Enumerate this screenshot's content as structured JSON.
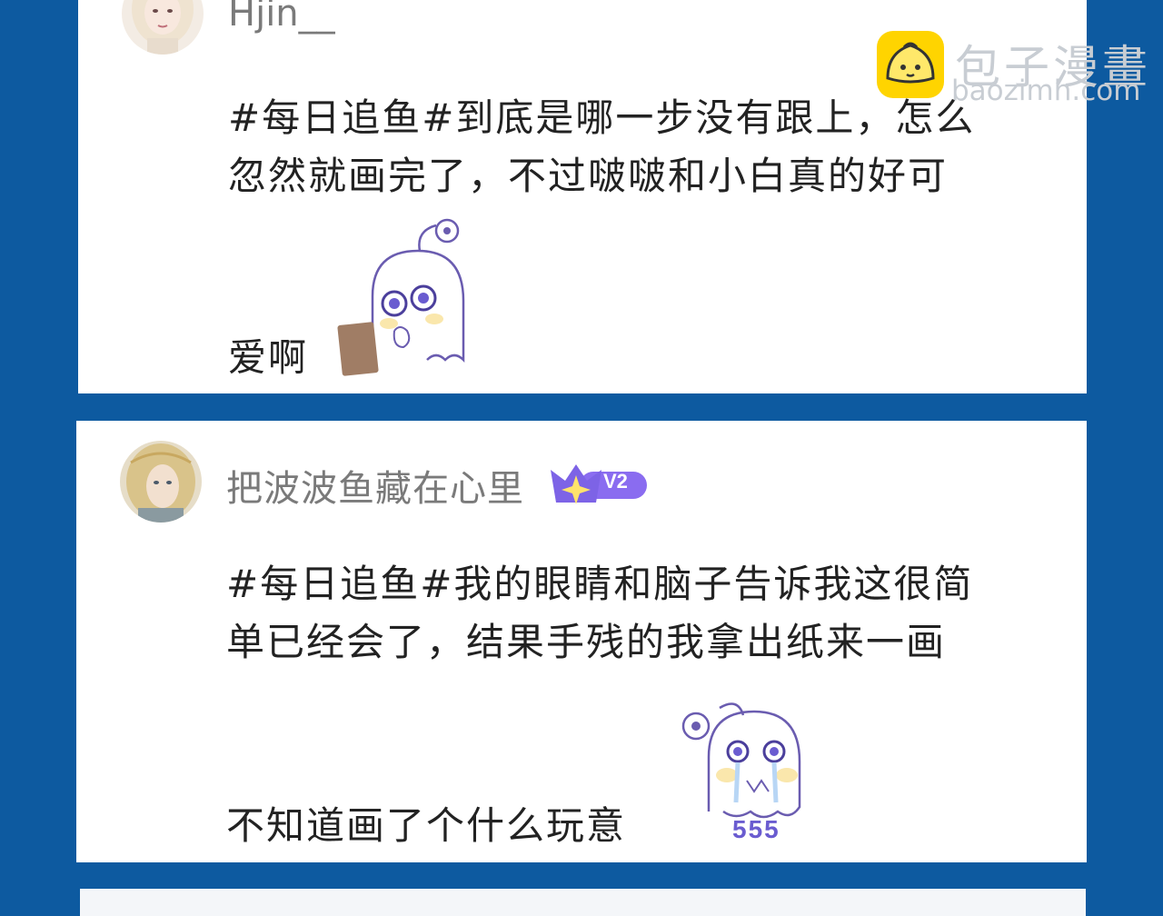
{
  "watermark": {
    "name": "包子漫畫",
    "url": "baozimh.com",
    "logo_color": "#ffd400"
  },
  "comments": [
    {
      "username": "Hjin__",
      "text_line1": "#每日追鱼#到底是哪一步没有跟上，怎么",
      "text_line2": "忽然就画完了，不过啵啵和小白真的好可",
      "text_tail": "爱啊",
      "sticker": "crying-ghost-holding-note-sticker"
    },
    {
      "username": "把波波鱼藏在心里",
      "badge": "V2",
      "text_line1": "#每日追鱼#我的眼睛和脑子告诉我这很简",
      "text_line2": "单已经会了，结果手残的我拿出纸来一画",
      "text_tail": "不知道画了个什么玩意",
      "sticker": "crying-ghost-555-sticker",
      "sticker_text": "555"
    }
  ],
  "colors": {
    "background": "#0d5aa0",
    "card": "#ffffff",
    "badge": "#8a6cf0"
  }
}
